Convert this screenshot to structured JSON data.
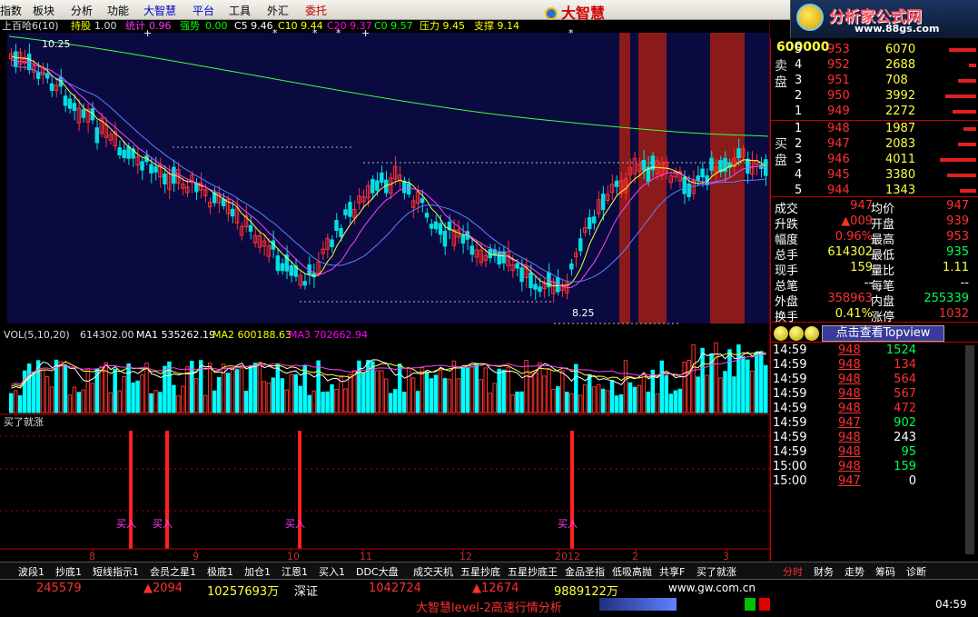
{
  "menu": {
    "items": [
      "指数",
      "板块",
      "分析",
      "功能",
      "大智慧",
      "平台",
      "工具",
      "外汇",
      "委托"
    ],
    "brand": "大智慧"
  },
  "logo": {
    "title": "分析家公式网",
    "url": "www.88gs.com"
  },
  "legend": {
    "stock": "上百哈6(10)",
    "hold_label": "持股",
    "hold_value": "1.00",
    "stat_label": "统计",
    "stat_value": "0.96",
    "strong_label": "强势",
    "strong_value": "0.00",
    "c5": "C5 9.46",
    "c10": "C10 9.44",
    "c20": "C20 9.37",
    "c0": "C0 9.57",
    "pressure": "压力 9.45",
    "support": "支撑 9.14",
    "high_mark": "10.25",
    "low_mark": "8.25"
  },
  "vol_legend": {
    "title": "VOL(5,10,20)",
    "vol": "614302.00",
    "ma1": "MA1 535262.19",
    "ma2": "MA2 600188.63",
    "ma3": "MA3 702662.94"
  },
  "indicator": {
    "title": "买了就涨",
    "signal_label": "买入"
  },
  "x_ticks": [
    "8",
    "9",
    "10",
    "11",
    "12",
    "2012",
    "2",
    "3"
  ],
  "quote": {
    "code": "600000",
    "sell_label": "卖盘",
    "buy_label": "买盘",
    "sells": [
      {
        "level": "5",
        "price": "953",
        "vol": "6070"
      },
      {
        "level": "4",
        "price": "952",
        "vol": "2688"
      },
      {
        "level": "3",
        "price": "951",
        "vol": "708"
      },
      {
        "level": "2",
        "price": "950",
        "vol": "3992"
      },
      {
        "level": "1",
        "price": "949",
        "vol": "2272"
      }
    ],
    "buys": [
      {
        "level": "1",
        "price": "948",
        "vol": "1987"
      },
      {
        "level": "2",
        "price": "947",
        "vol": "2083"
      },
      {
        "level": "3",
        "price": "946",
        "vol": "4011"
      },
      {
        "level": "4",
        "price": "945",
        "vol": "3380"
      },
      {
        "level": "5",
        "price": "944",
        "vol": "1343"
      }
    ],
    "stats": [
      {
        "l1": "成交",
        "v1": "947",
        "l2": "均价",
        "v2": "947"
      },
      {
        "l1": "升跌",
        "v1": "▲009",
        "l2": "开盘",
        "v2": "939"
      },
      {
        "l1": "幅度",
        "v1": "0.96%",
        "l2": "最高",
        "v2": "953"
      },
      {
        "l1": "总手",
        "v1": "614302",
        "l2": "最低",
        "v2": "935"
      },
      {
        "l1": "现手",
        "v1": "159",
        "l2": "量比",
        "v2": "1.11"
      },
      {
        "l1": "总笔",
        "v1": "--",
        "l2": "每笔",
        "v2": "--"
      },
      {
        "l1": "外盘",
        "v1": "358963",
        "l2": "内盘",
        "v2": "255339"
      },
      {
        "l1": "换手",
        "v1": "0.41%",
        "l2": "涨停",
        "v2": "1032"
      }
    ],
    "topview": "点击查看Topview",
    "ticks": [
      {
        "t": "14:59",
        "p": "948",
        "v": "1524"
      },
      {
        "t": "14:59",
        "p": "948",
        "v": "134"
      },
      {
        "t": "14:59",
        "p": "948",
        "v": "564"
      },
      {
        "t": "14:59",
        "p": "948",
        "v": "567"
      },
      {
        "t": "14:59",
        "p": "948",
        "v": "472"
      },
      {
        "t": "14:59",
        "p": "947",
        "v": "902"
      },
      {
        "t": "14:59",
        "p": "948",
        "v": "243"
      },
      {
        "t": "14:59",
        "p": "948",
        "v": "95"
      },
      {
        "t": "15:00",
        "p": "948",
        "v": "159"
      },
      {
        "t": "15:00",
        "p": "947",
        "v": "0"
      }
    ]
  },
  "tabs": [
    "波段1",
    "抄底1",
    "短线指示1",
    "会员之星1",
    "极底1",
    "加仓1",
    "江恩1",
    "买入1",
    "DDC大盘",
    "成交天机",
    "五星抄底",
    "五星抄底王",
    "金品圣指",
    "低吸高抛",
    "共享F",
    "买了就涨"
  ],
  "right_tabs": [
    "分时",
    "财务",
    "走势",
    "筹码",
    "诊断"
  ],
  "status": {
    "v1": "245579",
    "v2": "▲2094",
    "v3": "10257693万",
    "market": "深证",
    "v4": "1042724",
    "v5": "▲12674",
    "v6": "9889122万",
    "ticker": "大智慧level-2高速行情分析",
    "site": "www.gw.com.cn",
    "clock": "04:59"
  },
  "colors": {
    "up": "#ff3030",
    "down": "#00ffff",
    "bg_chart": "#0a0a40",
    "highlight": "#8b1a1a"
  }
}
